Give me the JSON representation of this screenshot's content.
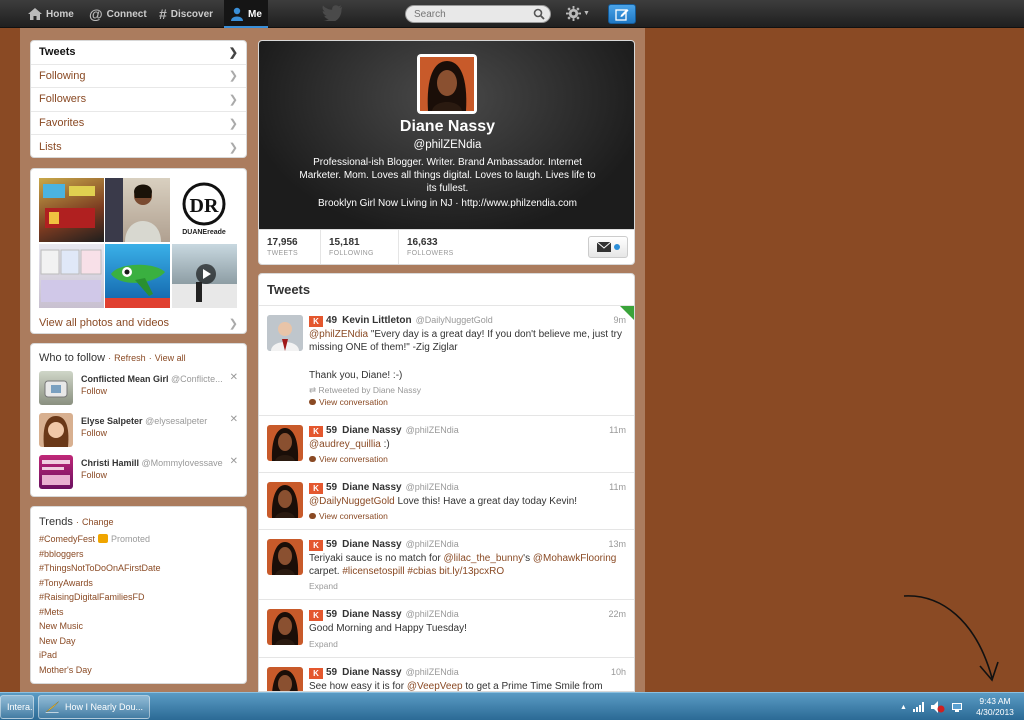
{
  "topbar": {
    "home": "Home",
    "connect": "Connect",
    "discover": "Discover",
    "me": "Me",
    "search_placeholder": "Search"
  },
  "left_nav": {
    "items": [
      {
        "label": "Tweets"
      },
      {
        "label": "Following"
      },
      {
        "label": "Followers"
      },
      {
        "label": "Favorites"
      },
      {
        "label": "Lists"
      }
    ]
  },
  "photos": {
    "link": "View all photos and videos"
  },
  "who_to_follow": {
    "title": "Who to follow",
    "refresh": "Refresh",
    "view_all": "View all",
    "sep": "·",
    "follow_label": "Follow",
    "close_glyph": "✕",
    "users": [
      {
        "name": "Conflicted Mean Girl",
        "handle": "@Conflicte..."
      },
      {
        "name": "Elyse Salpeter",
        "handle": "@elysesalpeter"
      },
      {
        "name": "Christi Hamill",
        "handle": "@Mommylovessave"
      }
    ]
  },
  "trends": {
    "title": "Trends",
    "change": "Change",
    "sep": "·",
    "promoted": "Promoted",
    "items": [
      "#ComedyFest",
      "#bbloggers",
      "#ThingsNotToDoOnAFirstDate",
      "#TonyAwards",
      "#RaisingDigitalFamiliesFD",
      "#Mets",
      "New Music",
      "New Day",
      "iPad",
      "Mother's Day"
    ]
  },
  "profile": {
    "name": "Diane Nassy",
    "handle": "@philZENdia",
    "bio": "Professional-ish Blogger. Writer. Brand Ambassador. Internet Marketer. Mom. Loves all things digital. Loves to laugh. Lives life to its fullest.",
    "location": "Brooklyn Girl Now Living in NJ",
    "loc_sep": "·",
    "url": "http://www.philzendia.com",
    "stats": [
      {
        "num": "17,956",
        "label": "TWEETS"
      },
      {
        "num": "15,181",
        "label": "FOLLOWING"
      },
      {
        "num": "16,633",
        "label": "FOLLOWERS"
      }
    ]
  },
  "timeline": {
    "title": "Tweets",
    "klout_glyph": "K",
    "tweets": [
      {
        "score": "49",
        "name": "Kevin Littleton",
        "handle": "@DailyNuggetGold",
        "time": "9m",
        "mention": "@philZENdia",
        "text": " \"Every day is a great day! If you don't believe me, just try missing ONE of them!\" -Zig Ziglar",
        "text2": "Thank you, Diane! :-)",
        "retweeted": "Retweeted by Diane Nassy",
        "action": "View conversation"
      },
      {
        "score": "59",
        "name": "Diane Nassy",
        "handle": "@philZENdia",
        "time": "11m",
        "mention": "@audrey_quillia",
        "text": " :)",
        "action": "View conversation"
      },
      {
        "score": "59",
        "name": "Diane Nassy",
        "handle": "@philZENdia",
        "time": "11m",
        "mention": "@DailyNuggetGold",
        "text": " Love this!  Have a great day today Kevin!",
        "action": "View conversation"
      },
      {
        "score": "59",
        "name": "Diane Nassy",
        "handle": "@philZENdia",
        "time": "13m",
        "t1": "Teriyaki sauce is no match for ",
        "m1": "@lilac_the_bunny",
        "t2": "'s ",
        "m2": "@MohawkFlooring",
        "t3": " carpet. ",
        "m3": "#licensetospill",
        "t4": " ",
        "m4": "#cbias",
        "t5": " ",
        "m5": "bit.ly/13pcxRO",
        "action": "Expand"
      },
      {
        "score": "59",
        "name": "Diane Nassy",
        "handle": "@philZENdia",
        "time": "22m",
        "text": "Good Morning and Happy Tuesday!",
        "action": "Expand"
      },
      {
        "score": "59",
        "name": "Diane Nassy",
        "handle": "@philZENdia",
        "time": "10h",
        "t1": "See how easy it is for ",
        "m1": "@VeepVeep",
        "t2": " to get a Prime Time Smile from"
      }
    ]
  },
  "taskbar": {
    "task1": "Intera...",
    "task2": "How I Nearly Dou...",
    "time": "9:43 AM",
    "date": "4/30/2013"
  },
  "colors": {
    "background": "#8a4a24",
    "link": "#8a4a24",
    "compose": "#1f78c4",
    "klout": "#e4572e"
  }
}
